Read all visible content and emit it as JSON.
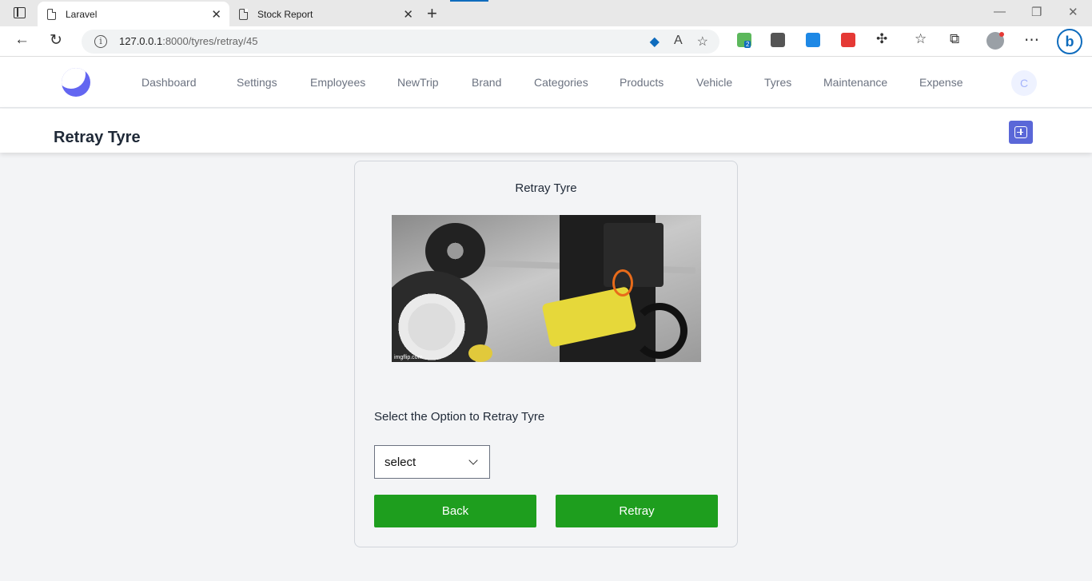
{
  "browser": {
    "tabs": [
      {
        "title": "Laravel",
        "active": true
      },
      {
        "title": "Stock Report",
        "active": false
      }
    ],
    "url_host": "127.0.0.1",
    "url_path": ":8000/tyres/retray/45",
    "extension_badge": "2"
  },
  "nav": {
    "links": [
      "Dashboard",
      "Settings",
      "Employees",
      "NewTrip",
      "Brand",
      "Categories",
      "Products",
      "Vehicle",
      "Tyres",
      "Maintenance",
      "Expense"
    ],
    "avatar_initial": "C",
    "accent_color": "#6366f1"
  },
  "header": {
    "title": "Retray Tyre"
  },
  "card": {
    "title": "Retray Tyre",
    "image_watermark": "imgflip.com",
    "select_label": "Select the Option to Retray Tyre",
    "select_value": "select",
    "back_label": "Back",
    "retray_label": "Retray",
    "button_color": "#1e9e1e"
  }
}
